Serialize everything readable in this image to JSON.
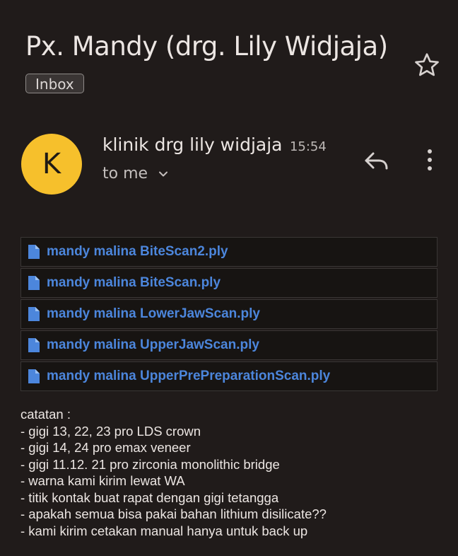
{
  "email": {
    "subject": "Px. Mandy (drg. Lily Widjaja)",
    "label": "Inbox",
    "star_icon": "star-outline-icon",
    "sender": {
      "avatar_letter": "K",
      "avatar_color": "#f6c02c",
      "name": "klinik drg lily widjaja",
      "time": "15:54",
      "recipient_label": "to me"
    },
    "actions": {
      "reply_icon": "reply-icon",
      "more_icon": "more-vert-icon"
    }
  },
  "attachments": [
    {
      "name": "mandy malina BiteScan2.ply"
    },
    {
      "name": "mandy malina BiteScan.ply"
    },
    {
      "name": "mandy malina LowerJawScan.ply"
    },
    {
      "name": "mandy malina UpperJawScan.ply"
    },
    {
      "name": "mandy malina UpperPrePreparationScan.ply"
    }
  ],
  "body": {
    "lines": [
      "catatan :",
      "- gigi 13, 22, 23 pro LDS crown",
      "- gigi 14, 24 pro emax veneer",
      "- gigi 11.12. 21 pro zirconia monolithic bridge",
      "- warna kami kirim lewat WA",
      "- titik kontak buat rapat dengan gigi tetangga",
      "- apakah semua bisa pakai bahan lithium disilicate??",
      "- kami kirim cetakan manual hanya untuk back up"
    ]
  },
  "colors": {
    "background": "#201b1a",
    "link": "#4c86dc",
    "file_icon": "#4c86dc"
  }
}
